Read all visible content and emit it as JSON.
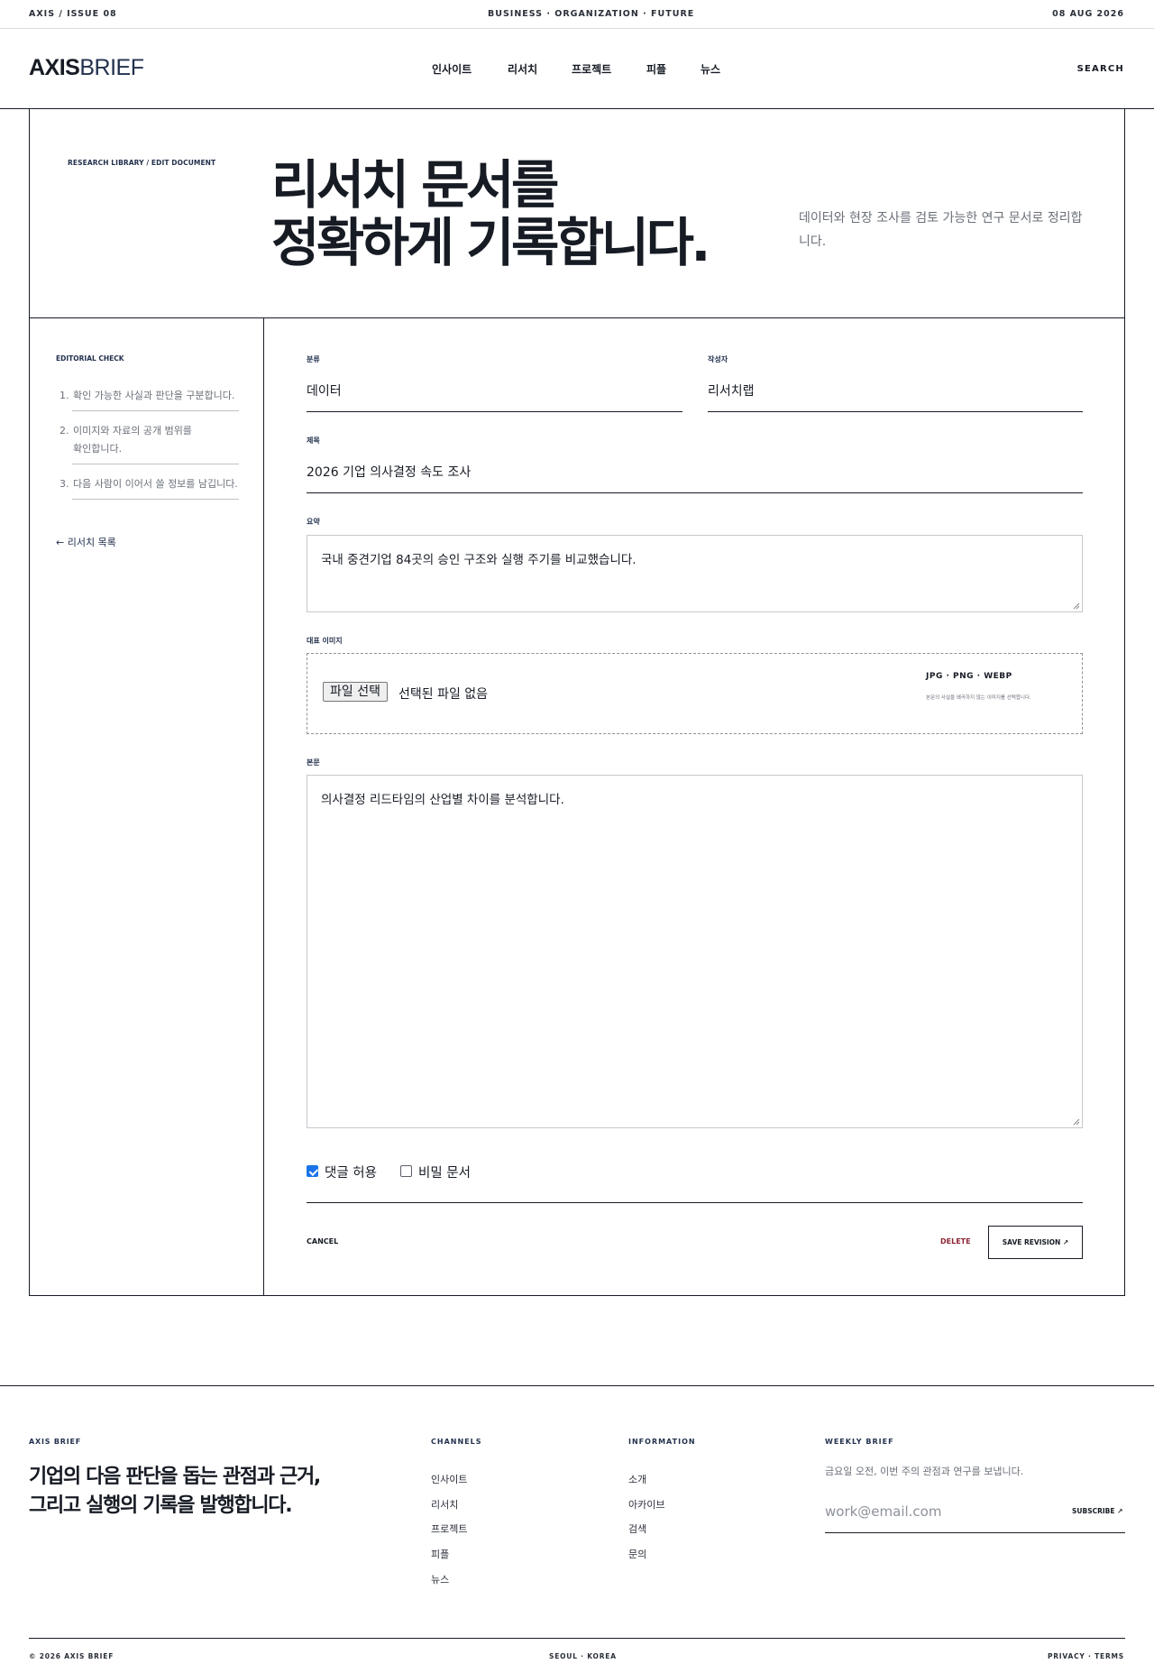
{
  "topbar": {
    "issue": "AXIS / ISSUE 08",
    "tagline": "BUSINESS · ORGANIZATION · FUTURE",
    "date": "08 AUG 2026"
  },
  "header": {
    "logo_bold": "AXIS",
    "logo_light": "BRIEF",
    "nav": [
      "인사이트",
      "리서치",
      "프로젝트",
      "피플",
      "뉴스"
    ],
    "search": "SEARCH"
  },
  "hero": {
    "breadcrumb": "RESEARCH LIBRARY / EDIT DOCUMENT",
    "title_line1": "리서치 문서를",
    "title_line2": "정확하게 기록합니다.",
    "description": "데이터와 현장 조사를 검토 가능한 연구 문서로 정리합니다."
  },
  "sidebar": {
    "title": "EDITORIAL CHECK",
    "items": [
      {
        "num": "1.",
        "text": "확인 가능한 사실과 판단을 구분합니다."
      },
      {
        "num": "2.",
        "text": "이미지와 자료의 공개 범위를 확인합니다."
      },
      {
        "num": "3.",
        "text": "다음 사람이 이어서 쓸 정보를 남깁니다."
      }
    ],
    "back_link": "← 리서치 목록"
  },
  "form": {
    "category_label": "분류",
    "category_value": "데이터",
    "author_label": "작성자",
    "author_value": "리서치랩",
    "title_label": "제목",
    "title_value": "2026 기업 의사결정 속도 조사",
    "summary_label": "요약",
    "summary_value": "국내 중견기업 84곳의 승인 구조와 실행 주기를 비교했습니다.",
    "image_label": "대표 이미지",
    "file_button": "파일 선택",
    "file_status": "선택된 파일 없음",
    "formats": "JPG · PNG · WEBP",
    "format_note": "본문의 사실을 왜곡하지 않는 이미지를 선택합니다.",
    "body_label": "본문",
    "body_value": "의사결정 리드타임의 산업별 차이를 분석합니다.",
    "allow_comments": "댓글 허용",
    "allow_comments_checked": true,
    "private_doc": "비밀 문서",
    "private_doc_checked": false,
    "cancel": "CANCEL",
    "delete": "DELETE",
    "save": "SAVE REVISION ↗",
    "colors": {
      "delete": "#8b2635",
      "checkbox": "#1a73e8"
    }
  },
  "footer": {
    "brand": "AXIS BRIEF",
    "tagline_line1": "기업의 다음 판단을 돕는 관점과 근거,",
    "tagline_line2": "그리고 실행의 기록을 발행합니다.",
    "channels_title": "CHANNELS",
    "channels": [
      "인사이트",
      "리서치",
      "프로젝트",
      "피플",
      "뉴스"
    ],
    "information_title": "INFORMATION",
    "information": [
      "소개",
      "아카이브",
      "검색",
      "문의"
    ],
    "weekly_title": "WEEKLY BRIEF",
    "weekly_desc": "금요일 오전, 이번 주의 관점과 연구를 보냅니다.",
    "email_placeholder": "work@email.com",
    "subscribe": "SUBSCRIBE ↗",
    "copyright": "© 2026 AXIS BRIEF",
    "location": "SEOUL · KOREA",
    "legal": "PRIVACY · TERMS"
  }
}
